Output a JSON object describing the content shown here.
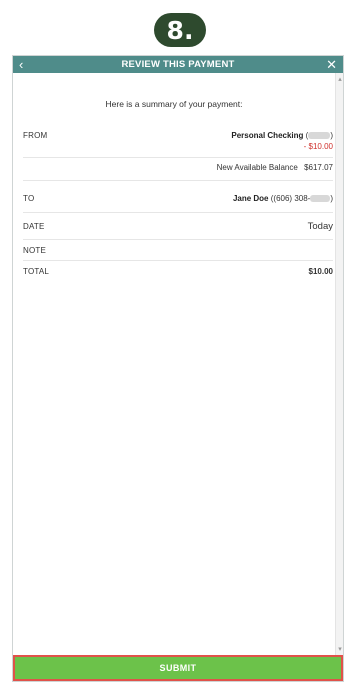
{
  "step_badge": "8.",
  "header": {
    "back_icon": "chevron-left-icon",
    "title": "REVIEW THIS PAYMENT",
    "close_icon": "close-icon"
  },
  "summary_text": "Here is a summary of your payment:",
  "from": {
    "label": "FROM",
    "account_name": "Personal Checking",
    "open_paren": "(",
    "close_paren": ")",
    "amount": "- $10.00",
    "balance_label": "New Available Balance",
    "balance_value": "$617.07"
  },
  "to": {
    "label": "TO",
    "payee_name": "Jane Doe",
    "phone_prefix": "((606) 308-",
    "close_paren": ")"
  },
  "date": {
    "label": "DATE",
    "value": "Today"
  },
  "note": {
    "label": "NOTE",
    "value": ""
  },
  "total": {
    "label": "TOTAL",
    "value": "$10.00"
  },
  "submit_label": "SUBMIT",
  "colors": {
    "header_bg": "#4f8c8a",
    "submit_bg": "#6cc24a",
    "submit_border": "#e0524a",
    "amount_red": "#d0312d",
    "badge_bg": "#2e4a2e"
  }
}
